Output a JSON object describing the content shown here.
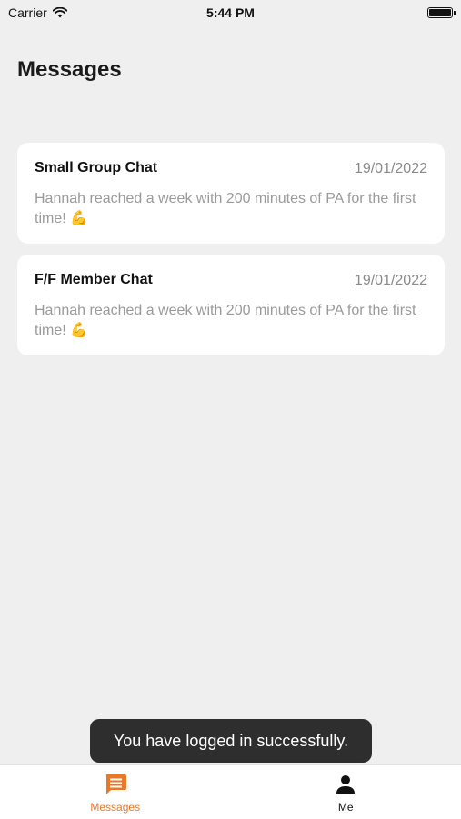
{
  "status_bar": {
    "carrier": "Carrier",
    "time": "5:44 PM",
    "wifi_icon": "wifi-icon",
    "battery_icon": "battery-icon"
  },
  "page": {
    "title": "Messages"
  },
  "chats": [
    {
      "name": "Small Group Chat",
      "date": "19/01/2022",
      "preview": "Hannah reached a week with 200 minutes of PA for the first time! 💪"
    },
    {
      "name": "F/F Member Chat",
      "date": "19/01/2022",
      "preview": "Hannah reached a week with 200 minutes of PA for the first time! 💪"
    }
  ],
  "toast": {
    "message": "You have logged in successfully."
  },
  "tab_bar": {
    "tabs": [
      {
        "label": "Messages",
        "icon": "message-icon",
        "active": true
      },
      {
        "label": "Me",
        "icon": "person-icon",
        "active": false
      }
    ]
  },
  "colors": {
    "accent": "#e8792b",
    "background": "#efefef",
    "card": "#ffffff",
    "toast": "#2e2e2e"
  }
}
